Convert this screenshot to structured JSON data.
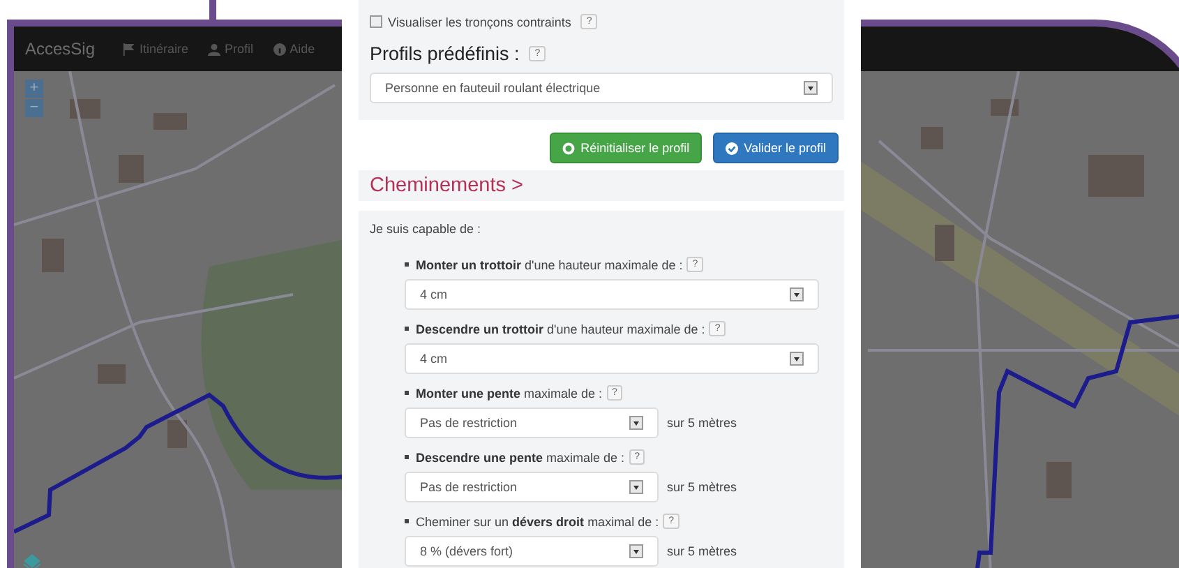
{
  "navbar": {
    "brand": "AccesSig",
    "items": [
      {
        "label": "Itinéraire",
        "kind": "flag"
      },
      {
        "label": "Profil",
        "kind": "user"
      },
      {
        "label": "Aide",
        "kind": "info"
      }
    ]
  },
  "map": {
    "zoom_buttons": [
      "+",
      "−"
    ]
  },
  "modal": {
    "constrained": {
      "label": "Visualiser les tronçons contraints",
      "checked": false,
      "help": "?"
    },
    "profiles": {
      "label": "Profils prédéfinis :",
      "help": "?",
      "value": "Personne en fauteuil roulant électrique"
    },
    "buttons": [
      {
        "label": "Réinitialiser le profil",
        "kind": "reset"
      },
      {
        "label": "Valider le profil",
        "kind": "validate"
      }
    ],
    "section_title": "Cheminements >",
    "intro": "Je suis capable de :",
    "criteria": [
      {
        "label": "**Monter un trottoir** d'une hauteur maximale de :",
        "help": "?",
        "value": "4 cm"
      },
      {
        "label": "**Descendre un trottoir** d'une hauteur maximale de :",
        "help": "?",
        "value": "4 cm"
      },
      {
        "label": "**Monter une pente** maximale de :",
        "help": "?",
        "value": "Pas de restriction",
        "suffix": "sur 5 mètres"
      },
      {
        "label": "**Descendre une pente** maximale de :",
        "help": "?",
        "value": "Pas de restriction",
        "suffix": "sur 5 mètres"
      },
      {
        "label": "Cheminer sur un **dévers droit** maximal de :",
        "help": "?",
        "value": "8 % (dévers fort)",
        "suffix": "sur 5 mètres"
      }
    ]
  }
}
